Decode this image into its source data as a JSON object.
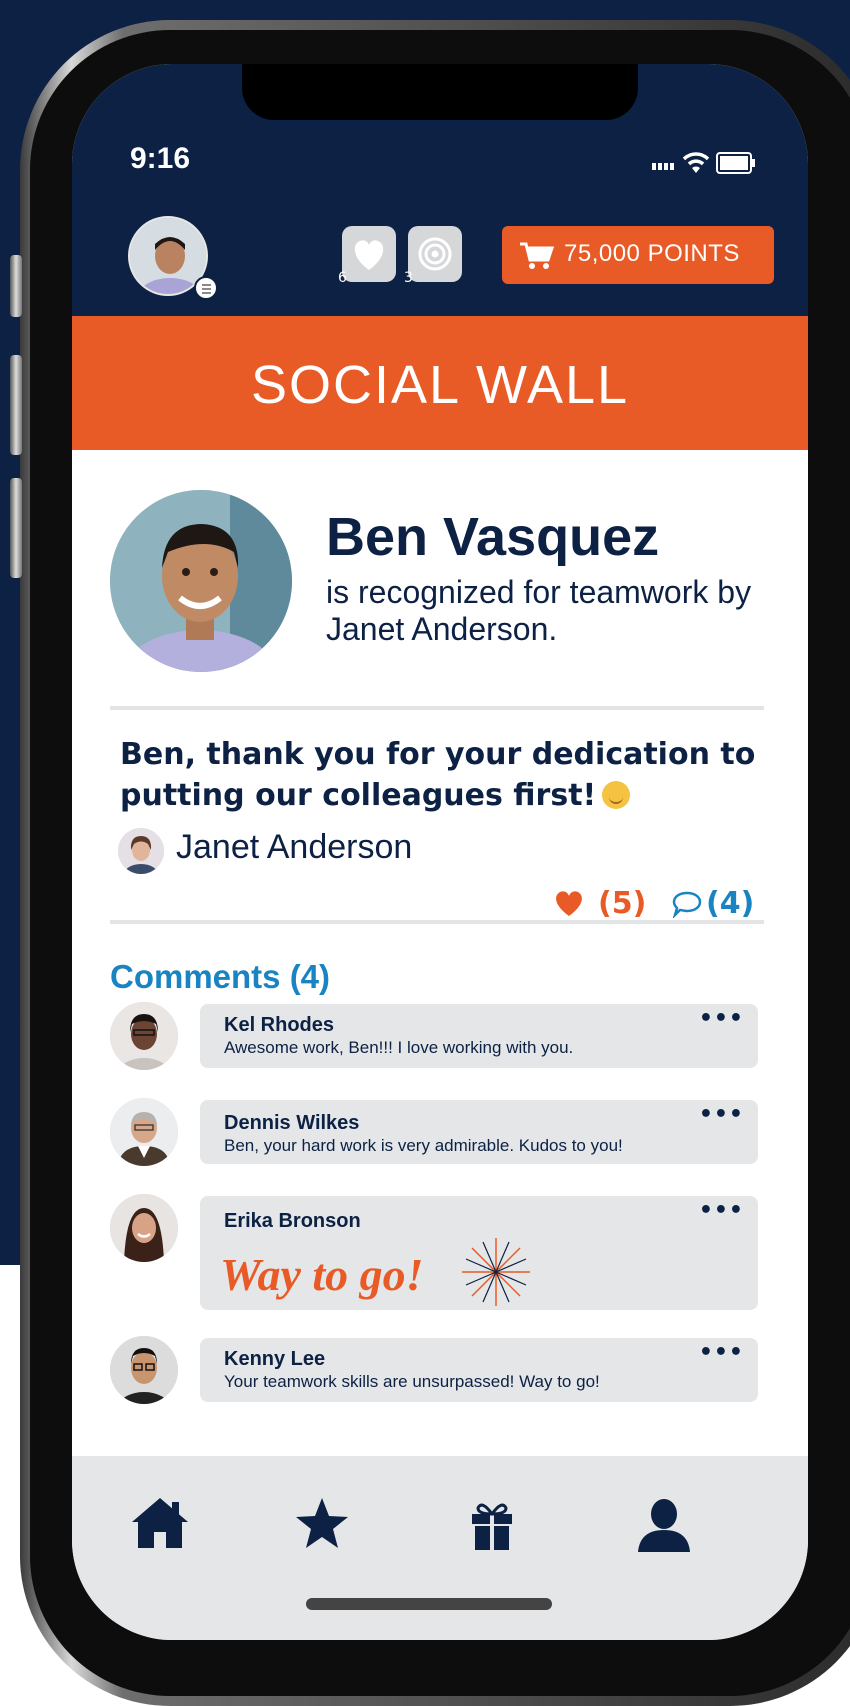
{
  "status_bar": {
    "time": "9:16"
  },
  "header": {
    "likes_badge_count": "6",
    "goals_badge_count": "3",
    "cart_label": "75,000 POINTS"
  },
  "banner": {
    "title": "SOCIAL WALL"
  },
  "recognition": {
    "name": "Ben Vasquez",
    "subtitle": "is recognized for teamwork by Janet Anderson.",
    "message": "Ben, thank you for your dedication to putting our colleagues first!",
    "author": "Janet Anderson",
    "likes": "(5)",
    "comments": "(4)"
  },
  "comments_section": {
    "title": "Comments (4)",
    "more_label": "•••",
    "items": [
      {
        "name": "Kel Rhodes",
        "text": "Awesome work, Ben!!! I love working with you."
      },
      {
        "name": "Dennis Wilkes",
        "text": "Ben, your hard work is very admirable. Kudos to you!"
      },
      {
        "name": "Erika Bronson",
        "sticker": "Way to go!"
      },
      {
        "name": "Kenny Lee",
        "text": "Your teamwork skills are unsurpassed! Way to go!"
      }
    ]
  },
  "colors": {
    "navy": "#0c2143",
    "orange": "#e85a26",
    "blue": "#1a84c2",
    "gray": "#e5e6e8"
  },
  "icons": {
    "tabs": [
      "home-icon",
      "star-icon",
      "gift-icon",
      "profile-icon"
    ],
    "header": [
      "heart-icon",
      "target-icon",
      "cart-icon"
    ]
  }
}
